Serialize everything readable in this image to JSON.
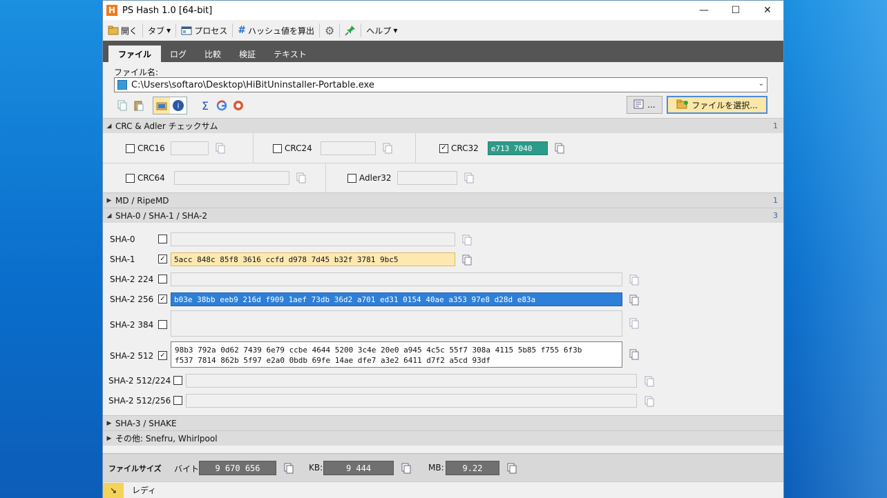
{
  "window": {
    "title": "PS Hash 1.0   [64-bit]",
    "icon_letter": "H"
  },
  "toolbar": {
    "open_label": "開く",
    "tab_label": "タブ",
    "process_label": "プロセス",
    "hash_label": "ハッシュ値を算出",
    "help_label": "ヘルプ"
  },
  "tabs": [
    {
      "label": "ファイル",
      "active": true
    },
    {
      "label": "ログ"
    },
    {
      "label": "比較"
    },
    {
      "label": "検証"
    },
    {
      "label": "テキスト"
    }
  ],
  "file": {
    "label": "ファイル名:",
    "path": "C:\\Users\\softaro\\Desktop\\HiBitUninstaller-Portable.exe",
    "dots_button": "...",
    "select_button": "ファイルを選択..."
  },
  "sections": {
    "crc": {
      "title": "CRC & Adler チェックサム",
      "count": "1"
    },
    "md": {
      "title": "MD / RipeMD",
      "count": "1"
    },
    "sha": {
      "title": "SHA-0 / SHA-1 / SHA-2",
      "count": "3"
    },
    "sha3": {
      "title": "SHA-3 / SHAKE"
    },
    "other": {
      "title": "その他: Snefru, Whirlpool"
    }
  },
  "crc": {
    "crc16": {
      "label": "CRC16",
      "value": "",
      "checked": false
    },
    "crc24": {
      "label": "CRC24",
      "value": "",
      "checked": false
    },
    "crc32": {
      "label": "CRC32",
      "value": "e713 7040",
      "checked": true
    },
    "crc64": {
      "label": "CRC64",
      "value": "",
      "checked": false
    },
    "adler32": {
      "label": "Adler32",
      "value": "",
      "checked": false
    }
  },
  "sha": {
    "sha0": {
      "label": "SHA-0",
      "value": "",
      "checked": false
    },
    "sha1": {
      "label": "SHA-1",
      "value": "5acc 848c 85f8 3616 ccfd d978 7d45 b32f 3781 9bc5",
      "checked": true
    },
    "sha224": {
      "label": "SHA-2 224",
      "value": "",
      "checked": false
    },
    "sha256": {
      "label": "SHA-2 256",
      "value": "b03e 38bb eeb9 216d f909 1aef 73db 36d2 a701 ed31 0154 40ae a353 97e8 d28d e83a",
      "checked": true
    },
    "sha384": {
      "label": "SHA-2 384",
      "value": "",
      "checked": false
    },
    "sha512": {
      "label": "SHA-2 512",
      "value_line1": "98b3 792a 0d62 7439 6e79 ccbe 4644 5200 3c4e 20e0 a945 4c5c 55f7 308a 4115 5b85 f755 6f3b",
      "value_line2": "f537 7814 862b 5f97 e2a0 0bdb 69fe 14ae dfe7 a3e2 6411 d7f2 a5cd 93df",
      "checked": true
    },
    "sha512_224": {
      "label": "SHA-2 512/224",
      "value": "",
      "checked": false
    },
    "sha512_256": {
      "label": "SHA-2 512/256",
      "value": "",
      "checked": false
    }
  },
  "filesize": {
    "title": "ファイルサイズ",
    "bytes_label": "バイト:",
    "bytes": "9 670 656",
    "kb_label": "KB:",
    "kb": "9 444",
    "mb_label": "MB:",
    "mb": "9.22"
  },
  "status": {
    "text": "レディ"
  },
  "colors": {
    "crc32_bg": "#2e9b8a",
    "sha1_bg": "#fde9b0",
    "sha256_bg": "#2e7fd8",
    "tab_bar": "#555555"
  }
}
